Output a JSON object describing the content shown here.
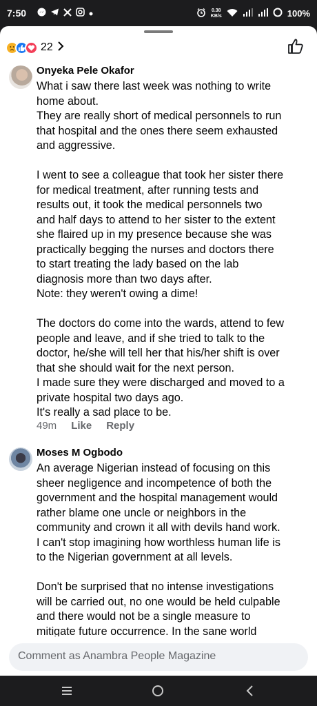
{
  "status_bar": {
    "time": "7:50",
    "left_icons": [
      "messenger-icon",
      "telegram-icon",
      "x-icon",
      "instagram-icon",
      "dot-icon"
    ],
    "speed_value": "0.38",
    "speed_unit": "KB/s",
    "battery": "100%"
  },
  "reactions": {
    "types": [
      "sad",
      "like",
      "love"
    ],
    "count": "22"
  },
  "comments": [
    {
      "author": "Onyeka Pele Okafor",
      "lines": [
        "What i saw there last week was nothing to write",
        "home about.",
        "They are really short of medical personnels to run",
        "that hospital and the ones there seem exhausted",
        "and aggressive.",
        "",
        "I went to see a colleague that took her sister there",
        "for medical treatment, after running tests and",
        "results out, it took the medical personnels two",
        "and half days to attend to her sister to the extent",
        "she flaired up in my presence because she was",
        "practically begging the nurses and doctors there",
        "to start treating the lady based on the lab",
        "diagnosis more than two days after.",
        "Note: they weren't owing a dime!",
        "",
        "The doctors do come into the wards, attend to few",
        "people and leave, and if she tried to talk to the",
        "doctor, he/she will tell her that his/her shift is over",
        "that she should wait for the next person.",
        "I made sure they were discharged and moved to a",
        "private hospital two days ago.",
        "It's really a sad place to be."
      ],
      "time": "49m",
      "like_label": "Like",
      "reply_label": "Reply"
    },
    {
      "author": "Moses M Ogbodo",
      "lines": [
        "An average Nigerian instead of focusing on this",
        "sheer negligence and incompetence of both the",
        "government and the hospital management would",
        "rather blame one uncle or neighbors in the",
        "community and crown it all with devils hand work.",
        "I can't stop imagining how worthless human life is",
        "to the Nigerian government at all levels.",
        "",
        "Don't be surprised that no intense investigations",
        "will be carried out, no one would be held culpable",
        "and there would not be a single measure to",
        "mitigate future occurrence. In the sane world"
      ]
    }
  ],
  "composer": {
    "placeholder": "Comment as Anambra People Magazine"
  },
  "nav": [
    "menu-icon",
    "home-icon",
    "back-icon"
  ]
}
